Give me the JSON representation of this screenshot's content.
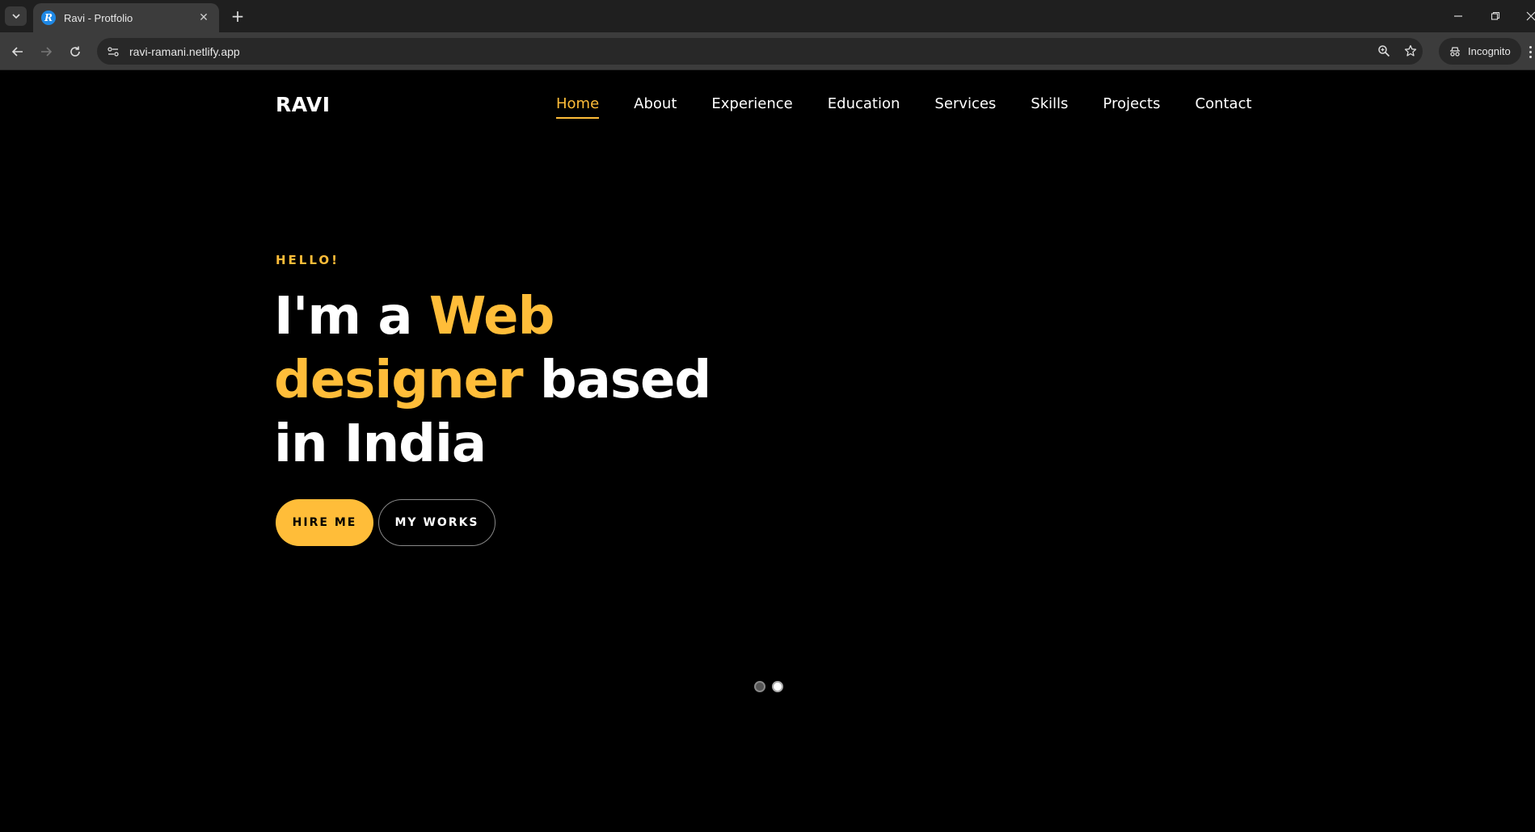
{
  "browser": {
    "tab_title": "Ravi - Protfolio",
    "favicon_letter": "R",
    "url": "ravi-ramani.netlify.app",
    "incognito_label": "Incognito",
    "new_tab_symbol": "+",
    "close_symbol": "✕"
  },
  "site": {
    "logo": "RAVI",
    "nav": [
      {
        "label": "Home",
        "active": true
      },
      {
        "label": "About",
        "active": false
      },
      {
        "label": "Experience",
        "active": false
      },
      {
        "label": "Education",
        "active": false
      },
      {
        "label": "Services",
        "active": false
      },
      {
        "label": "Skills",
        "active": false
      },
      {
        "label": "Projects",
        "active": false
      },
      {
        "label": "Contact",
        "active": false
      }
    ]
  },
  "hero": {
    "greeting": "HELLO!",
    "headline_part1": "I'm a ",
    "headline_highlight": "Web designer",
    "headline_part2": " based in India",
    "hire_button": "HIRE ME",
    "works_button": "MY WORKS"
  },
  "slider": {
    "count": 2,
    "active_index": 1
  },
  "colors": {
    "accent": "#ffbd39",
    "background": "#000000",
    "text": "#ffffff"
  }
}
